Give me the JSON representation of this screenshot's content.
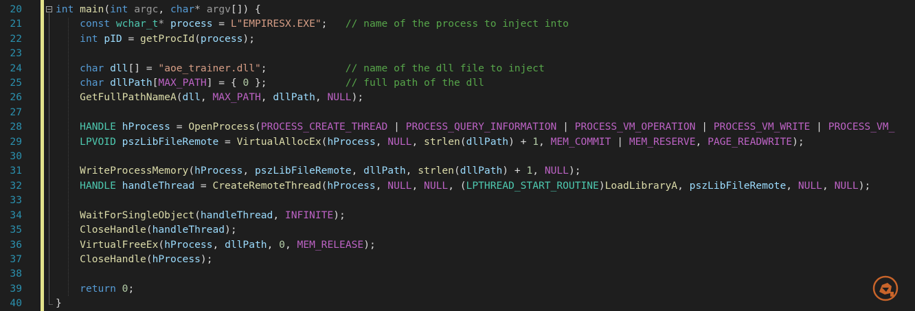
{
  "editor": {
    "language": "C++",
    "theme": "dark",
    "line_numbers": [
      "20",
      "21",
      "22",
      "23",
      "24",
      "25",
      "26",
      "27",
      "28",
      "29",
      "30",
      "31",
      "32",
      "33",
      "34",
      "35",
      "36",
      "37",
      "38",
      "39",
      "40"
    ],
    "lines": [
      [
        [
          "kw",
          "int"
        ],
        [
          "pl",
          " "
        ],
        [
          "fn",
          "main"
        ],
        [
          "pl",
          "("
        ],
        [
          "kw",
          "int"
        ],
        [
          "pl",
          " "
        ],
        [
          "pa",
          "argc"
        ],
        [
          "pl",
          ", "
        ],
        [
          "kw",
          "char"
        ],
        [
          "op",
          "*"
        ],
        [
          "pl",
          " "
        ],
        [
          "pa",
          "argv"
        ],
        [
          "pl",
          "[]) {"
        ]
      ],
      [
        [
          "pl",
          "    "
        ],
        [
          "kw",
          "const"
        ],
        [
          "pl",
          " "
        ],
        [
          "ty",
          "wchar_t"
        ],
        [
          "op",
          "*"
        ],
        [
          "pl",
          " "
        ],
        [
          "lv",
          "process"
        ],
        [
          "pl",
          " = "
        ],
        [
          "st",
          "L\"EMPIRESX.EXE\""
        ],
        [
          "pl",
          ";   "
        ],
        [
          "cm",
          "// name of the process to inject into"
        ]
      ],
      [
        [
          "pl",
          "    "
        ],
        [
          "kw",
          "int"
        ],
        [
          "pl",
          " "
        ],
        [
          "lv",
          "pID"
        ],
        [
          "pl",
          " = "
        ],
        [
          "fn",
          "getProcId"
        ],
        [
          "pl",
          "("
        ],
        [
          "lv",
          "process"
        ],
        [
          "pl",
          ");"
        ]
      ],
      [
        [
          "pl",
          ""
        ]
      ],
      [
        [
          "pl",
          "    "
        ],
        [
          "kw",
          "char"
        ],
        [
          "pl",
          " "
        ],
        [
          "lv",
          "dll"
        ],
        [
          "pl",
          "[] = "
        ],
        [
          "st",
          "\"aoe_trainer.dll\""
        ],
        [
          "pl",
          ";             "
        ],
        [
          "cm",
          "// name of the dll file to inject"
        ]
      ],
      [
        [
          "pl",
          "    "
        ],
        [
          "kw",
          "char"
        ],
        [
          "pl",
          " "
        ],
        [
          "lv",
          "dllPath"
        ],
        [
          "pl",
          "["
        ],
        [
          "mc",
          "MAX_PATH"
        ],
        [
          "pl",
          "] = { "
        ],
        [
          "nu",
          "0"
        ],
        [
          "pl",
          " };             "
        ],
        [
          "cm",
          "// full path of the dll"
        ]
      ],
      [
        [
          "pl",
          "    "
        ],
        [
          "fn",
          "GetFullPathNameA"
        ],
        [
          "pl",
          "("
        ],
        [
          "lv",
          "dll"
        ],
        [
          "pl",
          ", "
        ],
        [
          "mc",
          "MAX_PATH"
        ],
        [
          "pl",
          ", "
        ],
        [
          "lv",
          "dllPath"
        ],
        [
          "pl",
          ", "
        ],
        [
          "mc",
          "NULL"
        ],
        [
          "pl",
          ");"
        ]
      ],
      [
        [
          "pl",
          ""
        ]
      ],
      [
        [
          "pl",
          "    "
        ],
        [
          "ty",
          "HANDLE"
        ],
        [
          "pl",
          " "
        ],
        [
          "lv",
          "hProcess"
        ],
        [
          "pl",
          " = "
        ],
        [
          "fn",
          "OpenProcess"
        ],
        [
          "pl",
          "("
        ],
        [
          "mc",
          "PROCESS_CREATE_THREAD"
        ],
        [
          "pl",
          " | "
        ],
        [
          "mc",
          "PROCESS_QUERY_INFORMATION"
        ],
        [
          "pl",
          " | "
        ],
        [
          "mc",
          "PROCESS_VM_OPERATION"
        ],
        [
          "pl",
          " | "
        ],
        [
          "mc",
          "PROCESS_VM_WRITE"
        ],
        [
          "pl",
          " | "
        ],
        [
          "mc",
          "PROCESS_VM_"
        ]
      ],
      [
        [
          "pl",
          "    "
        ],
        [
          "ty",
          "LPVOID"
        ],
        [
          "pl",
          " "
        ],
        [
          "lv",
          "pszLibFileRemote"
        ],
        [
          "pl",
          " = "
        ],
        [
          "fn",
          "VirtualAllocEx"
        ],
        [
          "pl",
          "("
        ],
        [
          "lv",
          "hProcess"
        ],
        [
          "pl",
          ", "
        ],
        [
          "mc",
          "NULL"
        ],
        [
          "pl",
          ", "
        ],
        [
          "fn",
          "strlen"
        ],
        [
          "pl",
          "("
        ],
        [
          "lv",
          "dllPath"
        ],
        [
          "pl",
          ") + "
        ],
        [
          "nu",
          "1"
        ],
        [
          "pl",
          ", "
        ],
        [
          "mc",
          "MEM_COMMIT"
        ],
        [
          "pl",
          " | "
        ],
        [
          "mc",
          "MEM_RESERVE"
        ],
        [
          "pl",
          ", "
        ],
        [
          "mc",
          "PAGE_READWRITE"
        ],
        [
          "pl",
          ");"
        ]
      ],
      [
        [
          "pl",
          ""
        ]
      ],
      [
        [
          "pl",
          "    "
        ],
        [
          "fn",
          "WriteProcessMemory"
        ],
        [
          "pl",
          "("
        ],
        [
          "lv",
          "hProcess"
        ],
        [
          "pl",
          ", "
        ],
        [
          "lv",
          "pszLibFileRemote"
        ],
        [
          "pl",
          ", "
        ],
        [
          "lv",
          "dllPath"
        ],
        [
          "pl",
          ", "
        ],
        [
          "fn",
          "strlen"
        ],
        [
          "pl",
          "("
        ],
        [
          "lv",
          "dllPath"
        ],
        [
          "pl",
          ") + "
        ],
        [
          "nu",
          "1"
        ],
        [
          "pl",
          ", "
        ],
        [
          "mc",
          "NULL"
        ],
        [
          "pl",
          ");"
        ]
      ],
      [
        [
          "pl",
          "    "
        ],
        [
          "ty",
          "HANDLE"
        ],
        [
          "pl",
          " "
        ],
        [
          "lv",
          "handleThread"
        ],
        [
          "pl",
          " = "
        ],
        [
          "fn",
          "CreateRemoteThread"
        ],
        [
          "pl",
          "("
        ],
        [
          "lv",
          "hProcess"
        ],
        [
          "pl",
          ", "
        ],
        [
          "mc",
          "NULL"
        ],
        [
          "pl",
          ", "
        ],
        [
          "mc",
          "NULL"
        ],
        [
          "pl",
          ", ("
        ],
        [
          "ty",
          "LPTHREAD_START_ROUTINE"
        ],
        [
          "pl",
          ")"
        ],
        [
          "fn",
          "LoadLibraryA"
        ],
        [
          "pl",
          ", "
        ],
        [
          "lv",
          "pszLibFileRemote"
        ],
        [
          "pl",
          ", "
        ],
        [
          "mc",
          "NULL"
        ],
        [
          "pl",
          ", "
        ],
        [
          "mc",
          "NULL"
        ],
        [
          "pl",
          ");"
        ]
      ],
      [
        [
          "pl",
          ""
        ]
      ],
      [
        [
          "pl",
          "    "
        ],
        [
          "fn",
          "WaitForSingleObject"
        ],
        [
          "pl",
          "("
        ],
        [
          "lv",
          "handleThread"
        ],
        [
          "pl",
          ", "
        ],
        [
          "mc",
          "INFINITE"
        ],
        [
          "pl",
          ");"
        ]
      ],
      [
        [
          "pl",
          "    "
        ],
        [
          "fn",
          "CloseHandle"
        ],
        [
          "pl",
          "("
        ],
        [
          "lv",
          "handleThread"
        ],
        [
          "pl",
          ");"
        ]
      ],
      [
        [
          "pl",
          "    "
        ],
        [
          "fn",
          "VirtualFreeEx"
        ],
        [
          "pl",
          "("
        ],
        [
          "lv",
          "hProcess"
        ],
        [
          "pl",
          ", "
        ],
        [
          "lv",
          "dllPath"
        ],
        [
          "pl",
          ", "
        ],
        [
          "nu",
          "0"
        ],
        [
          "pl",
          ", "
        ],
        [
          "mc",
          "MEM_RELEASE"
        ],
        [
          "pl",
          ");"
        ]
      ],
      [
        [
          "pl",
          "    "
        ],
        [
          "fn",
          "CloseHandle"
        ],
        [
          "pl",
          "("
        ],
        [
          "lv",
          "hProcess"
        ],
        [
          "pl",
          ");"
        ]
      ],
      [
        [
          "pl",
          ""
        ]
      ],
      [
        [
          "pl",
          "    "
        ],
        [
          "kw",
          "return"
        ],
        [
          "pl",
          " "
        ],
        [
          "nu",
          "0"
        ],
        [
          "pl",
          ";"
        ]
      ],
      [
        [
          "pl",
          "}"
        ]
      ]
    ]
  },
  "colors": {
    "background": "#1e1e1e",
    "line_number": "#2b91af",
    "keyword": "#569cd6",
    "type": "#4ec9b0",
    "function": "#dcdcaa",
    "parameter": "#9a9a9a",
    "local_variable": "#9cdcfe",
    "macro": "#bd63c5",
    "string": "#d69d85",
    "number": "#b5cea8",
    "comment": "#57a64a",
    "change_bar": "#e2e28b"
  },
  "icons": {
    "fold": "collapse-minus-icon",
    "watermark": "logo-watermark-icon"
  }
}
